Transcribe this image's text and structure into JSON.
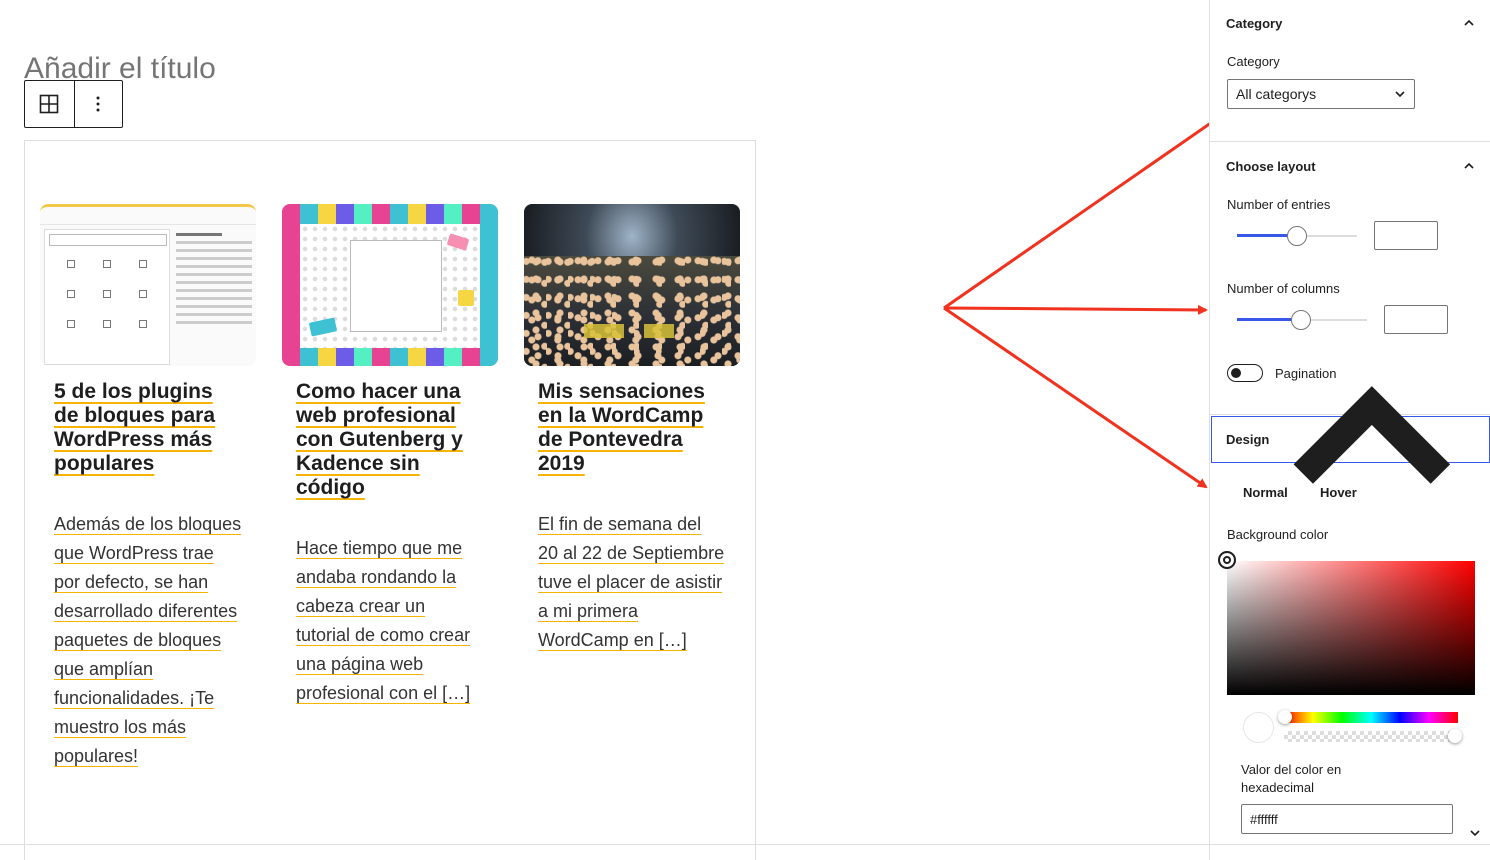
{
  "editor": {
    "title_placeholder": "Añadir el título",
    "toolbar": {
      "block_icon": "grid-icon",
      "options_icon": "more-vertical-icon"
    }
  },
  "posts": [
    {
      "title": "5 de los plugins de bloques para WordPress más populares",
      "excerpt": "Además de los bloques que WordPress trae por defecto, se han desarrollado diferentes paquetes de bloques que amplían funcionalidades. ¡Te muestro los más populares!"
    },
    {
      "title": "Como hacer una web profesional con Gutenberg y Kadence sin código",
      "excerpt": "Hace tiempo que me andaba rondando la cabeza crear un tutorial de como crear una página web profesional con el […]"
    },
    {
      "title": "Mis sensaciones en la WordCamp de Pontevedra 2019",
      "excerpt": "El fin de semana del 20 al 22 de Septiembre tuve el placer de asistir a mi primera WordCamp en […]"
    }
  ],
  "sidebar": {
    "category_panel": {
      "title": "Category",
      "field_label": "Category",
      "selected": "All categorys"
    },
    "layout_panel": {
      "title": "Choose layout",
      "entries_label": "Number of entries",
      "entries_value": "",
      "columns_label": "Number of columns",
      "columns_value": "",
      "pagination_label": "Pagination",
      "pagination_on": false
    },
    "design_panel": {
      "title": "Design",
      "tabs": [
        "Normal",
        "Hover"
      ],
      "bg_color_label": "Background color",
      "hex_label": "Valor del color en hexadecimal",
      "hex_value": "#ffffff"
    }
  },
  "colors": {
    "accent": "#3858e9",
    "arrow": "#f0321e",
    "link_underline": "#f5b400",
    "picker_hue": "#ff0000"
  }
}
